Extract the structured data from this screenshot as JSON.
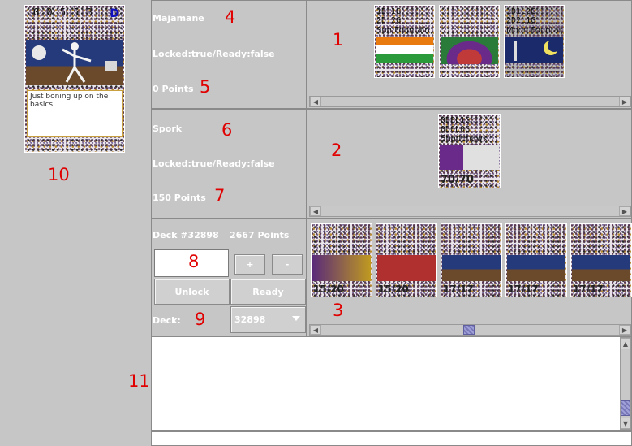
{
  "preview_card": {
    "title_code": "0 0 5 5 3",
    "cost_mark": "D",
    "text": "Just boning up on the basics"
  },
  "players": [
    {
      "name": "Majamane",
      "status": "Locked:true/Ready:false",
      "points": "0 Points"
    },
    {
      "name": "Spork",
      "status": "Locked:true/Ready:false",
      "points": "150 Points"
    }
  ],
  "zone1_cards": [
    {
      "code_line1": "1D 1G",
      "code_line2": "2D 2G",
      "name": "Sun Fountain"
    },
    {
      "code_line1": "",
      "code_line2": "",
      "name": ""
    },
    {
      "code_line1": "1D1L2G",
      "code_line2": "2D2L1G",
      "name": "Moon Fountai"
    }
  ],
  "zone2_cards": [
    {
      "code_line1": "0D0L1G",
      "code_line2": "0D0L0G",
      "name": "Shadehawk",
      "stats": "70/70"
    }
  ],
  "deck_panel": {
    "deck_label": "Deck #32898",
    "points_label": "2667 Points",
    "input_value": "",
    "plus_label": "+",
    "minus_label": "-",
    "unlock_label": "Unlock",
    "ready_label": "Ready",
    "deck_field_label": "Deck:",
    "deck_select_value": "32898"
  },
  "hand_cards": [
    {
      "stats": "15/20"
    },
    {
      "stats": "15/20"
    },
    {
      "stats": "17/17"
    },
    {
      "stats": "17/17"
    },
    {
      "stats": "17/17"
    }
  ],
  "chat": {
    "log_text": "",
    "input_value": ""
  },
  "markers": {
    "m1": "1",
    "m2": "2",
    "m3": "3",
    "m4": "4",
    "m5": "5",
    "m6": "6",
    "m7": "7",
    "m8": "8",
    "m9": "9",
    "m10": "10",
    "m11": "11"
  },
  "colors": {
    "background": "#c6c6c6",
    "label_text": "#ffffff",
    "marker_red": "#e00000",
    "scroll_thumb": "#9090c8"
  }
}
